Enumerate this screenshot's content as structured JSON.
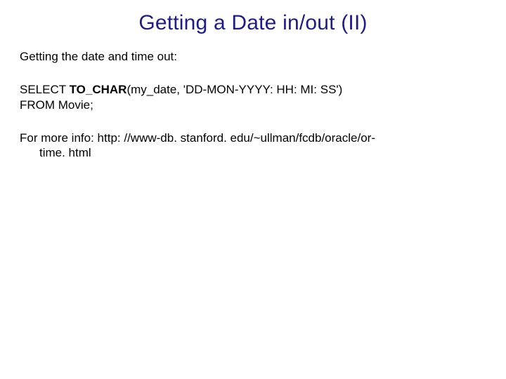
{
  "title": "Getting a Date in/out (II)",
  "intro": "Getting the date and time out:",
  "sql": {
    "select_kw": "SELECT ",
    "tochar": "TO_CHAR",
    "tochar_args": "(my_date, 'DD-MON-YYYY: HH: MI: SS')",
    "from": "FROM Movie;"
  },
  "more": {
    "label": "For more info: ",
    "url_part1": "http: //www-db. stanford. edu/~ullman/fcdb/oracle/or-",
    "url_part2": "time. html"
  }
}
